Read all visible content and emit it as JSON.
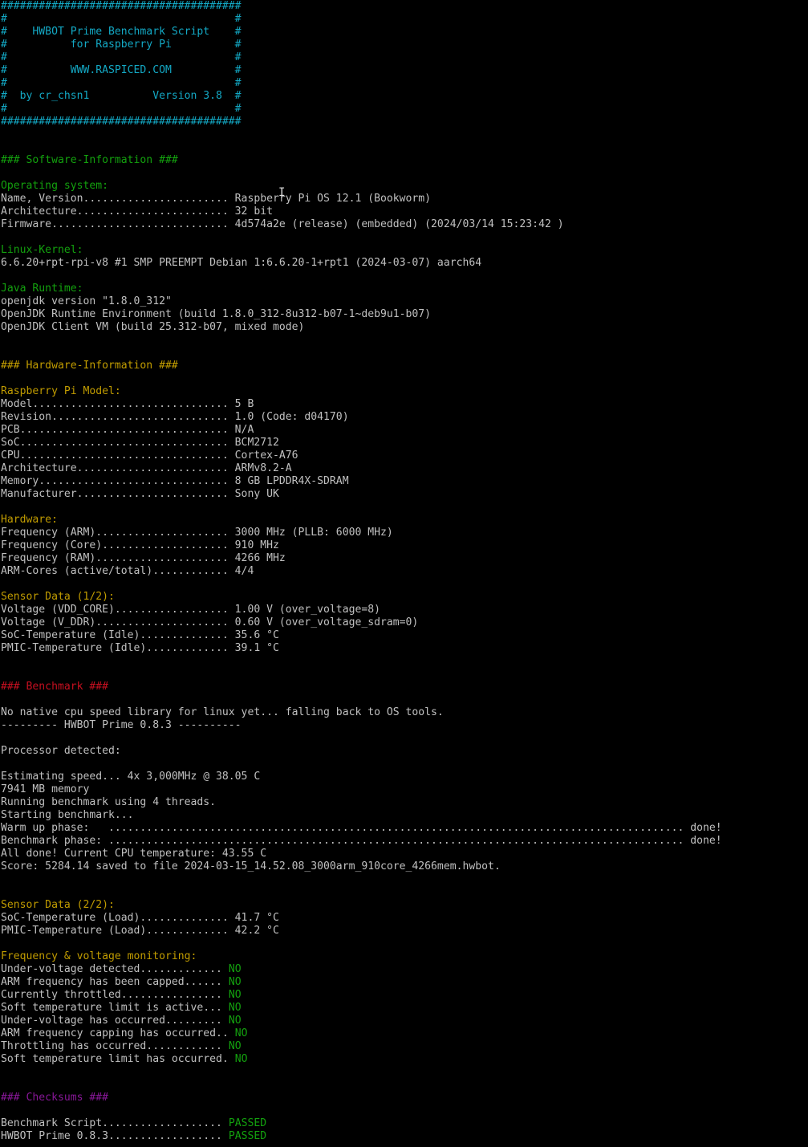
{
  "colors": {
    "background": "#000000",
    "text": "#c0c0c0",
    "cyan": "#13a8c4",
    "green": "#13a10e",
    "yellow": "#c19c00",
    "red": "#c50f1f",
    "magenta": "#881798"
  },
  "cursor_icon": "i-beam-text-cursor",
  "lines": [
    {
      "text": "######################################",
      "color": "cyan"
    },
    {
      "text": "#                                    #",
      "color": "cyan"
    },
    {
      "text": "#    HWBOT Prime Benchmark Script    #",
      "color": "cyan"
    },
    {
      "text": "#          for Raspberry Pi          #",
      "color": "cyan"
    },
    {
      "text": "#                                    #",
      "color": "cyan"
    },
    {
      "text": "#          WWW.RASPICED.COM          #",
      "color": "cyan"
    },
    {
      "text": "#                                    #",
      "color": "cyan"
    },
    {
      "text": "#  by cr_chsn1          Version 3.8  #",
      "color": "cyan"
    },
    {
      "text": "#                                    #",
      "color": "cyan"
    },
    {
      "text": "######################################",
      "color": "cyan"
    },
    {
      "text": "",
      "color": ""
    },
    {
      "text": "",
      "color": ""
    },
    {
      "text": "### Software-Information ###",
      "color": "green"
    },
    {
      "text": "",
      "color": ""
    },
    {
      "text": "Operating system:",
      "color": "green"
    },
    {
      "text": "Name, Version....................... Raspberry Pi OS 12.1 (Bookworm)",
      "color": ""
    },
    {
      "text": "Architecture........................ 32 bit",
      "color": ""
    },
    {
      "text": "Firmware............................ 4d574a2e (release) (embedded) (2024/03/14 15:23:42 )",
      "color": ""
    },
    {
      "text": "",
      "color": ""
    },
    {
      "text": "Linux-Kernel:",
      "color": "green"
    },
    {
      "text": "6.6.20+rpt-rpi-v8 #1 SMP PREEMPT Debian 1:6.6.20-1+rpt1 (2024-03-07) aarch64",
      "color": ""
    },
    {
      "text": "",
      "color": ""
    },
    {
      "text": "Java Runtime:",
      "color": "green"
    },
    {
      "text": "openjdk version \"1.8.0_312\"",
      "color": ""
    },
    {
      "text": "OpenJDK Runtime Environment (build 1.8.0_312-8u312-b07-1~deb9u1-b07)",
      "color": ""
    },
    {
      "text": "OpenJDK Client VM (build 25.312-b07, mixed mode)",
      "color": ""
    },
    {
      "text": "",
      "color": ""
    },
    {
      "text": "",
      "color": ""
    },
    {
      "text": "### Hardware-Information ###",
      "color": "yellow"
    },
    {
      "text": "",
      "color": ""
    },
    {
      "text": "Raspberry Pi Model:",
      "color": "yellow"
    },
    {
      "text": "Model............................... 5 B",
      "color": ""
    },
    {
      "text": "Revision............................ 1.0 (Code: d04170)",
      "color": ""
    },
    {
      "text": "PCB................................. N/A",
      "color": ""
    },
    {
      "text": "SoC................................. BCM2712",
      "color": ""
    },
    {
      "text": "CPU................................. Cortex-A76",
      "color": ""
    },
    {
      "text": "Architecture........................ ARMv8.2-A",
      "color": ""
    },
    {
      "text": "Memory.............................. 8 GB LPDDR4X-SDRAM",
      "color": ""
    },
    {
      "text": "Manufacturer........................ Sony UK",
      "color": ""
    },
    {
      "text": "",
      "color": ""
    },
    {
      "text": "Hardware:",
      "color": "yellow"
    },
    {
      "text": "Frequency (ARM)..................... 3000 MHz (PLLB: 6000 MHz)",
      "color": ""
    },
    {
      "text": "Frequency (Core).................... 910 MHz",
      "color": ""
    },
    {
      "text": "Frequency (RAM)..................... 4266 MHz",
      "color": ""
    },
    {
      "text": "ARM-Cores (active/total)............ 4/4",
      "color": ""
    },
    {
      "text": "",
      "color": ""
    },
    {
      "text": "Sensor Data (1/2):",
      "color": "yellow"
    },
    {
      "text": "Voltage (VDD_CORE).................. 1.00 V (over_voltage=8)",
      "color": ""
    },
    {
      "text": "Voltage (V_DDR)..................... 0.60 V (over_voltage_sdram=0)",
      "color": ""
    },
    {
      "text": "SoC-Temperature (Idle).............. 35.6 °C",
      "color": ""
    },
    {
      "text": "PMIC-Temperature (Idle)............. 39.1 °C",
      "color": ""
    },
    {
      "text": "",
      "color": ""
    },
    {
      "text": "",
      "color": ""
    },
    {
      "text": "### Benchmark ###",
      "color": "red"
    },
    {
      "text": "",
      "color": ""
    },
    {
      "text": "No native cpu speed library for linux yet... falling back to OS tools.",
      "color": ""
    },
    {
      "text": "--------- HWBOT Prime 0.8.3 ----------",
      "color": ""
    },
    {
      "text": "",
      "color": ""
    },
    {
      "text": "Processor detected:",
      "color": ""
    },
    {
      "text": "",
      "color": ""
    },
    {
      "text": "Estimating speed... 4x 3,000MHz @ 38.05 C",
      "color": ""
    },
    {
      "text": "7941 MB memory",
      "color": ""
    },
    {
      "text": "Running benchmark using 4 threads.",
      "color": ""
    },
    {
      "text": "Starting benchmark...",
      "color": ""
    },
    {
      "text": "Warm up phase:   ........................................................................................... done!",
      "color": ""
    },
    {
      "text": "Benchmark phase: ........................................................................................... done!",
      "color": ""
    },
    {
      "text": "All done! Current CPU temperature: 43.55 C",
      "color": ""
    },
    {
      "text": "Score: 5284.14 saved to file 2024-03-15_14.52.08_3000arm_910core_4266mem.hwbot.",
      "color": ""
    },
    {
      "text": "",
      "color": ""
    },
    {
      "text": "",
      "color": ""
    },
    {
      "text": "Sensor Data (2/2):",
      "color": "yellow"
    },
    {
      "text": "SoC-Temperature (Load).............. 41.7 °C",
      "color": ""
    },
    {
      "text": "PMIC-Temperature (Load)............. 42.2 °C",
      "color": ""
    },
    {
      "text": "",
      "color": ""
    },
    {
      "text": "Frequency & voltage monitoring:",
      "color": "yellow"
    },
    {
      "text": "Under-voltage detected.............",
      "value": "NO"
    },
    {
      "text": "ARM frequency has been capped......",
      "value": "NO"
    },
    {
      "text": "Currently throttled................",
      "value": "NO"
    },
    {
      "text": "Soft temperature limit is active...",
      "value": "NO"
    },
    {
      "text": "Under-voltage has occurred.........",
      "value": "NO"
    },
    {
      "text": "ARM frequency capping has occurred..",
      "value": "NO"
    },
    {
      "text": "Throttling has occurred............",
      "value": "NO"
    },
    {
      "text": "Soft temperature limit has occurred.",
      "value": "NO"
    },
    {
      "text": "",
      "color": ""
    },
    {
      "text": "",
      "color": ""
    },
    {
      "text": "### Checksums ###",
      "color": "magenta"
    },
    {
      "text": "",
      "color": ""
    },
    {
      "text": "Benchmark Script...................",
      "value": "PASSED"
    },
    {
      "text": "HWBOT Prime 0.8.3..................",
      "value": "PASSED"
    }
  ]
}
